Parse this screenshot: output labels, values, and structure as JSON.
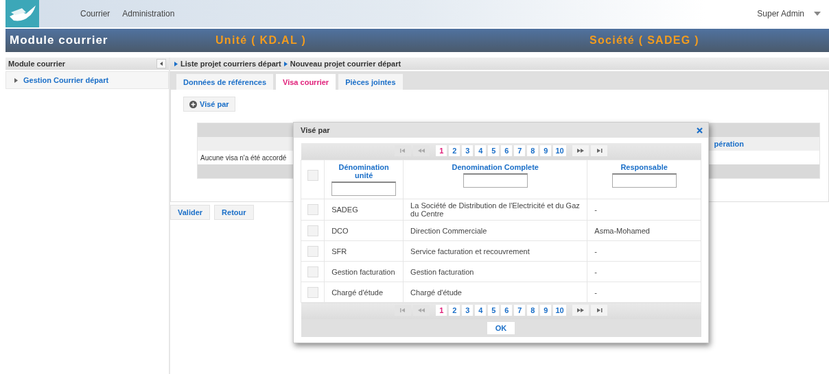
{
  "top_nav": {
    "items": [
      "Courrier",
      "Administration"
    ],
    "user": "Super Admin"
  },
  "header": {
    "title": "Module courrier",
    "unit": "Unité ( KD.AL )",
    "company": "Société ( SADEG )"
  },
  "sidebar": {
    "title": "Module courrier",
    "items": [
      {
        "label": "Gestion Courrier départ"
      }
    ]
  },
  "breadcrumb": [
    "Liste projet courriers départ",
    "Nouveau projet courrier départ"
  ],
  "tabs": [
    {
      "label": "Données de références",
      "selected": false
    },
    {
      "label": "Visa courrier",
      "selected": true
    },
    {
      "label": "Pièces jointes",
      "selected": false
    }
  ],
  "add_button": "Visé par",
  "visa_table": {
    "column_end": "pération",
    "empty_message": "Aucune visa n'a été accordé"
  },
  "buttons": [
    "Valider",
    "Retour"
  ],
  "dialog": {
    "title": "Visé par",
    "pager_top": {
      "pages": [
        {
          "label": "1",
          "selected": true
        },
        {
          "label": "2",
          "selected": false
        },
        {
          "label": "3",
          "selected": false
        },
        {
          "label": "4",
          "selected": false
        },
        {
          "label": "5",
          "selected": false
        },
        {
          "label": "6",
          "selected": false
        },
        {
          "label": "7",
          "selected": false
        },
        {
          "label": "8",
          "selected": false
        },
        {
          "label": "9",
          "selected": false
        },
        {
          "label": "10",
          "selected": false
        }
      ]
    },
    "select_all_checked": false,
    "columns": [
      "Dénomination unité",
      "Denomination Complete",
      "Responsable"
    ],
    "rows": [
      {
        "checked": false,
        "cells": [
          "SADEG",
          "La Société de Distribution de l'Electricité et du Gaz du Centre",
          "-"
        ]
      },
      {
        "checked": false,
        "cells": [
          "DCO",
          "Direction Commerciale",
          "Asma-Mohamed"
        ]
      },
      {
        "checked": false,
        "cells": [
          "SFR",
          "Service facturation et recouvrement",
          "-"
        ]
      },
      {
        "checked": false,
        "cells": [
          "Gestion facturation",
          "Gestion facturation",
          "-"
        ]
      },
      {
        "checked": false,
        "cells": [
          "Chargé d'étude",
          "Chargé d'étude",
          "-"
        ]
      }
    ],
    "pager_bottom": {
      "pages": [
        {
          "label": "1",
          "selected": true
        },
        {
          "label": "2",
          "selected": false
        },
        {
          "label": "3",
          "selected": false
        },
        {
          "label": "4",
          "selected": false
        },
        {
          "label": "5",
          "selected": false
        },
        {
          "label": "6",
          "selected": false
        },
        {
          "label": "7",
          "selected": false
        },
        {
          "label": "8",
          "selected": false
        },
        {
          "label": "9",
          "selected": false
        },
        {
          "label": "10",
          "selected": false
        }
      ]
    },
    "ok": "OK"
  }
}
